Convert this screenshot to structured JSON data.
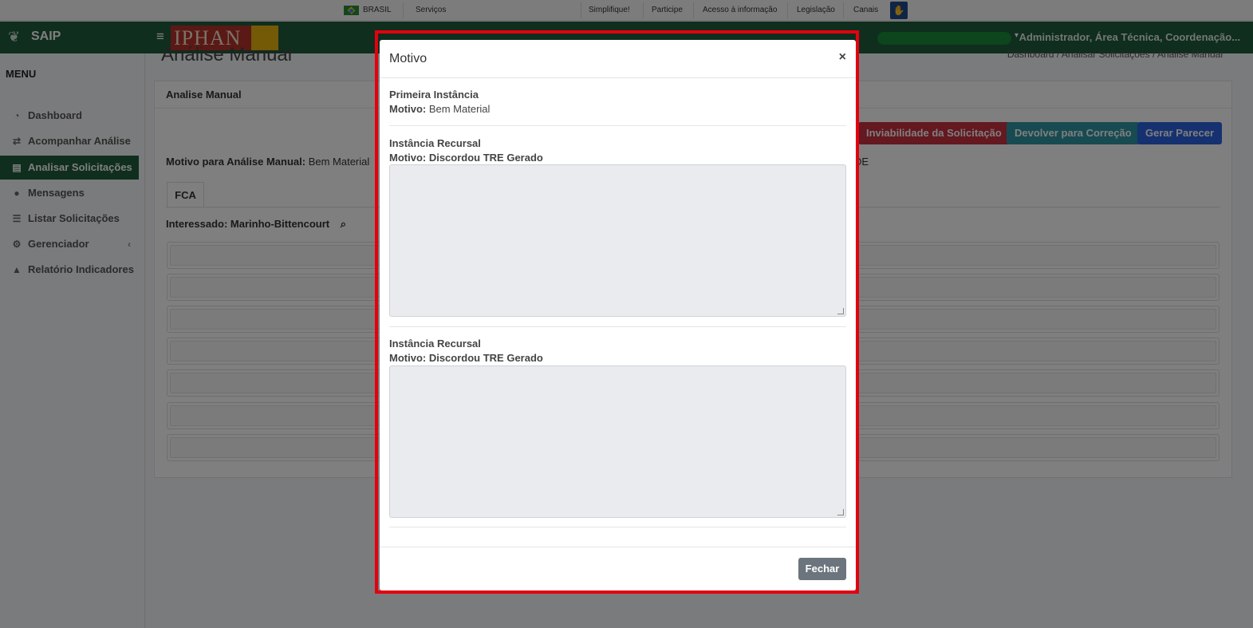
{
  "govbar": {
    "country": "BRASIL",
    "links": [
      "Serviços",
      "Simplifique!",
      "Participe",
      "Acesso à informação",
      "Legislação",
      "Canais"
    ]
  },
  "brand": {
    "name": "SAIP",
    "logo_text": "IPHAN"
  },
  "header": {
    "user_label": "Administrador, Área Técnica, Coordenação..."
  },
  "sidebar": {
    "title": "MENU",
    "items": [
      {
        "label": "Dashboard",
        "icon": "dashboard-icon"
      },
      {
        "label": "Acompanhar Análise",
        "icon": "exchange-icon"
      },
      {
        "label": "Analisar Solicitações",
        "icon": "book-icon",
        "active": true
      },
      {
        "label": "Mensagens",
        "icon": "comments-icon"
      },
      {
        "label": "Listar Solicitações",
        "icon": "list-icon"
      },
      {
        "label": "Gerenciador",
        "icon": "cogs-icon"
      },
      {
        "label": "Relatório Indicadores",
        "icon": "area-chart-icon"
      }
    ]
  },
  "page": {
    "title": "Análise Manual",
    "breadcrumb": "Dashboard / Analisar Solicitações / Análise Manual",
    "card_title": "Analise Manual",
    "buttons": {
      "inviabilidade": "Inviabilidade da Solicitação",
      "devolver": "Devolver para Correção",
      "gerar": "Gerar Parecer"
    },
    "motivo_label": "Motivo para Análise Manual:",
    "motivo_value": "Bem Material",
    "tail_text": "DE",
    "tab": "FCA",
    "interessado": "Interessado: Marinho-Bittencourt"
  },
  "modal": {
    "title": "Motivo",
    "close": "×",
    "sections": [
      {
        "heading": "Primeira Instância",
        "motivo_label": "Motivo:",
        "motivo_value": "Bem Material"
      },
      {
        "heading": "Instância Recursal",
        "motivo_label": "Motivo: Discordou TRE Gerado",
        "motivo_value": ""
      },
      {
        "heading": "Instância Recursal",
        "motivo_label": "Motivo: Discordou TRE Gerado",
        "motivo_value": ""
      }
    ],
    "close_button": "Fechar"
  },
  "colors": {
    "brand_green": "#1f5c3d",
    "danger": "#c8303f",
    "info": "#2e97a3",
    "primary": "#2b63e0",
    "secondary": "#6c757d",
    "highlight": "#e3000f"
  }
}
